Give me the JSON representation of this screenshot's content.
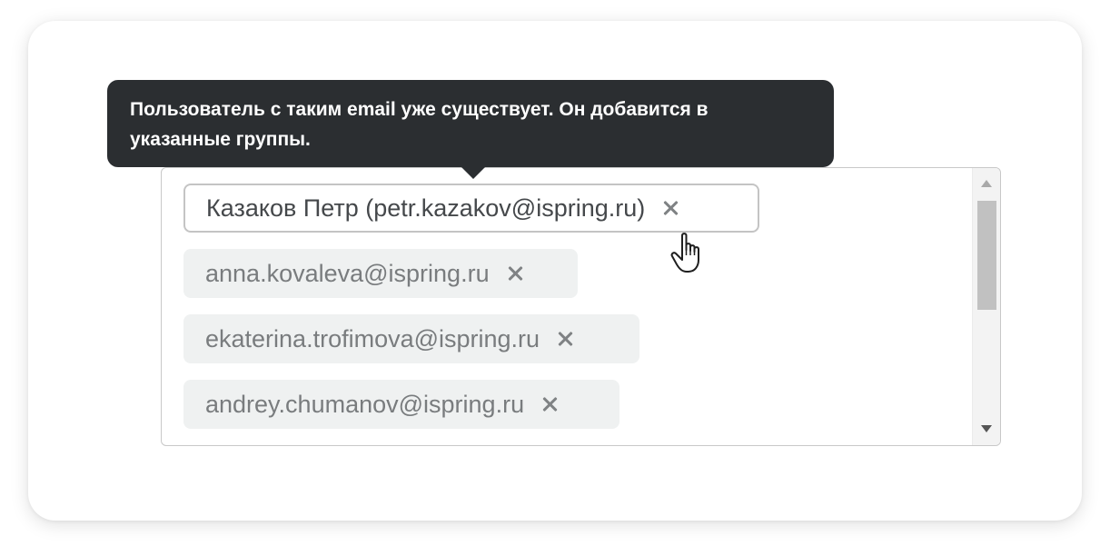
{
  "tooltip": {
    "text": "Пользователь с таким email уже существует. Он добавится в указанные группы."
  },
  "recipients": {
    "tags": [
      {
        "label": "Казаков Петр (petr.kazakov@ispring.ru)",
        "state": "selected"
      },
      {
        "label": "anna.kovaleva@ispring.ru",
        "state": "default"
      },
      {
        "label": "ekaterina.trofimova@ispring.ru",
        "state": "default"
      },
      {
        "label": "andrey.chumanov@ispring.ru",
        "state": "default"
      }
    ]
  },
  "icons": {
    "remove": "close-icon",
    "cursor": "hand-pointer-cursor",
    "scroll_up": "arrow-up-icon",
    "scroll_down": "arrow-down-icon"
  },
  "colors": {
    "tooltip_bg": "#2b2e31",
    "tag_bg": "#eff1f1",
    "tag_text": "#797c7e",
    "selected_tag_text": "#45484b",
    "border": "#c8c8c8"
  }
}
